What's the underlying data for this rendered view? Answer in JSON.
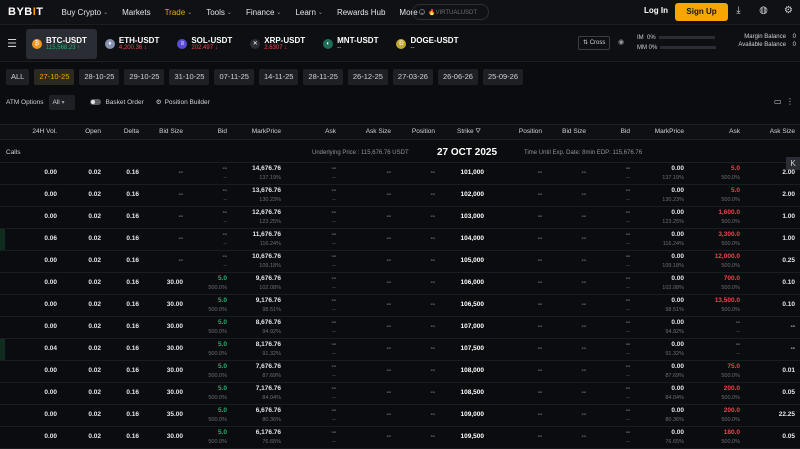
{
  "nav": {
    "logo": "BYB",
    "logo_i": "I",
    "logo_t": "T",
    "items": [
      {
        "label": "Buy Crypto",
        "chev": true
      },
      {
        "label": "Markets",
        "chev": false
      },
      {
        "label": "Trade",
        "chev": true,
        "active": true
      },
      {
        "label": "Tools",
        "chev": true
      },
      {
        "label": "Finance",
        "chev": true
      },
      {
        "label": "Learn",
        "chev": true
      },
      {
        "label": "Rewards Hub",
        "chev": false
      },
      {
        "label": "More",
        "chev": true
      }
    ],
    "search_placeholder": "🔥VIRTUALUSDT",
    "login": "Log In",
    "signup": "Sign Up"
  },
  "tickers": [
    {
      "name": "BTC-USDT",
      "price": "115,568.23",
      "dir": "up",
      "coin": "₿",
      "color": "#f7931a",
      "selected": true
    },
    {
      "name": "ETH-USDT",
      "price": "4,200.36",
      "dir": "dn",
      "coin": "♦",
      "color": "#8a92b2"
    },
    {
      "name": "SOL-USDT",
      "price": "202.497",
      "dir": "dn",
      "coin": "≡",
      "color": "#5a4bd6"
    },
    {
      "name": "XRP-USDT",
      "price": "2.6307",
      "dir": "dn",
      "coin": "✕",
      "color": "#2a2d33"
    },
    {
      "name": "MNT-USDT",
      "price": "--",
      "dir": "",
      "coin": "◐",
      "color": "#1e6e57"
    },
    {
      "name": "DOGE-USDT",
      "price": "--",
      "dir": "",
      "coin": "Ð",
      "color": "#c2a633"
    }
  ],
  "account": {
    "cross": "Cross",
    "im_label": "IM",
    "im_value": "0%",
    "mm_label": "MM",
    "mm_value": "0%",
    "margin_balance_label": "Margin Balance",
    "margin_balance": "0",
    "available_balance_label": "Available Balance",
    "available_balance": "0"
  },
  "dates": {
    "all": "ALL",
    "list": [
      "27-10-25",
      "28-10-25",
      "29-10-25",
      "31-10-25",
      "07-11-25",
      "14-11-25",
      "28-11-25",
      "26-12-25",
      "27-03-26",
      "26-06-26",
      "25-09-26"
    ],
    "selected_index": 0
  },
  "options_bar": {
    "atm_label": "ATM Options",
    "atm_value": "All",
    "basket": "Basket Order",
    "builder": "Position Builder"
  },
  "headers": {
    "left": [
      "24H Vol.",
      "Open",
      "Delta",
      "Bid Size",
      "Bid",
      "MarkPrice",
      "Ask",
      "Ask Size",
      "Position"
    ],
    "strike": "Strike",
    "right": [
      "Position",
      "Bid Size",
      "Bid",
      "MarkPrice",
      "Ask",
      "Ask Size"
    ]
  },
  "info": {
    "calls": "Calls",
    "underlying": "Underlying Price : 115,676.76 USDT",
    "expiry": "27 OCT 2025",
    "time_until": "Time Until Exp. Date:  8min  EDP: 115,676.76"
  },
  "rows": [
    {
      "vol": "0.00",
      "open": "0.02",
      "delta": "0.16",
      "bsz": "--",
      "bid": "--",
      "mark": "14,676.76",
      "markiv": "137.19%",
      "ask": "--",
      "asz": "--",
      "pos": "--",
      "strike": "101,000",
      "rpos": "--",
      "rbsz": "--",
      "rbid": "--",
      "rmark": "0.00",
      "rmarkiv": "137.19%",
      "rask": "5.0",
      "raskiv": "500.0%",
      "rasz": "2.00",
      "rbid_sub": "--",
      "bid_sub": "--",
      "ask_sub": "--"
    },
    {
      "vol": "0.00",
      "open": "0.02",
      "delta": "0.16",
      "bsz": "--",
      "bid": "--",
      "mark": "13,676.76",
      "markiv": "130.23%",
      "ask": "--",
      "asz": "--",
      "pos": "--",
      "strike": "102,000",
      "rpos": "--",
      "rbsz": "--",
      "rbid": "--",
      "rmark": "0.00",
      "rmarkiv": "130.23%",
      "rask": "5.0",
      "raskiv": "500.0%",
      "rasz": "2.00",
      "rbid_sub": "--",
      "bid_sub": "--",
      "ask_sub": "--"
    },
    {
      "vol": "0.00",
      "open": "0.02",
      "delta": "0.16",
      "bsz": "--",
      "bid": "--",
      "mark": "12,676.76",
      "markiv": "123.25%",
      "ask": "--",
      "asz": "--",
      "pos": "--",
      "strike": "103,000",
      "rpos": "--",
      "rbsz": "--",
      "rbid": "--",
      "rmark": "0.00",
      "rmarkiv": "123.25%",
      "rask": "1,600.0",
      "raskiv": "500.0%",
      "rasz": "1.00",
      "rbid_sub": "--",
      "bid_sub": "--",
      "ask_sub": "--"
    },
    {
      "vol": "0.06",
      "open": "0.02",
      "delta": "0.16",
      "bsz": "--",
      "bid": "--",
      "mark": "11,676.76",
      "markiv": "116.24%",
      "ask": "--",
      "asz": "--",
      "pos": "--",
      "strike": "104,000",
      "rpos": "--",
      "rbsz": "--",
      "rbid": "--",
      "rmark": "0.00",
      "rmarkiv": "116.24%",
      "rask": "3,300.0",
      "raskiv": "500.0%",
      "rasz": "1.00",
      "rbid_sub": "--",
      "bid_sub": "--",
      "ask_sub": "--",
      "gbar": true
    },
    {
      "vol": "0.00",
      "open": "0.02",
      "delta": "0.16",
      "bsz": "--",
      "bid": "--",
      "mark": "10,676.76",
      "markiv": "109.18%",
      "ask": "--",
      "asz": "--",
      "pos": "--",
      "strike": "105,000",
      "rpos": "--",
      "rbsz": "--",
      "rbid": "--",
      "rmark": "0.00",
      "rmarkiv": "109.18%",
      "rask": "12,000.0",
      "raskiv": "500.0%",
      "rasz": "0.25",
      "rbid_sub": "--",
      "bid_sub": "--",
      "ask_sub": "--"
    },
    {
      "vol": "0.00",
      "open": "0.02",
      "delta": "0.16",
      "bsz": "30.00",
      "bid": "5.0",
      "mark": "9,676.76",
      "markiv": "102.08%",
      "ask": "--",
      "asz": "--",
      "pos": "--",
      "strike": "106,000",
      "rpos": "--",
      "rbsz": "--",
      "rbid": "--",
      "rmark": "0.00",
      "rmarkiv": "102.08%",
      "rask": "700.0",
      "raskiv": "500.0%",
      "rasz": "0.10",
      "rbid_sub": "--",
      "bid_sub": "500.0%",
      "ask_sub": "--"
    },
    {
      "vol": "0.00",
      "open": "0.02",
      "delta": "0.16",
      "bsz": "30.00",
      "bid": "5.0",
      "mark": "9,176.76",
      "markiv": "98.51%",
      "ask": "--",
      "asz": "--",
      "pos": "--",
      "strike": "106,500",
      "rpos": "--",
      "rbsz": "--",
      "rbid": "--",
      "rmark": "0.00",
      "rmarkiv": "98.51%",
      "rask": "13,500.0",
      "raskiv": "500.0%",
      "rasz": "0.10",
      "rbid_sub": "--",
      "bid_sub": "500.0%",
      "ask_sub": "--"
    },
    {
      "vol": "0.00",
      "open": "0.02",
      "delta": "0.16",
      "bsz": "30.00",
      "bid": "5.0",
      "mark": "8,676.76",
      "markiv": "94.92%",
      "ask": "--",
      "asz": "--",
      "pos": "--",
      "strike": "107,000",
      "rpos": "--",
      "rbsz": "--",
      "rbid": "--",
      "rmark": "0.00",
      "rmarkiv": "94.92%",
      "rask": "--",
      "raskiv": "--",
      "rasz": "--",
      "rbid_sub": "--",
      "bid_sub": "500.0%",
      "ask_sub": "--"
    },
    {
      "vol": "0.04",
      "open": "0.02",
      "delta": "0.16",
      "bsz": "30.00",
      "bid": "5.0",
      "mark": "8,176.76",
      "markiv": "91.32%",
      "ask": "--",
      "asz": "--",
      "pos": "--",
      "strike": "107,500",
      "rpos": "--",
      "rbsz": "--",
      "rbid": "--",
      "rmark": "0.00",
      "rmarkiv": "91.32%",
      "rask": "--",
      "raskiv": "--",
      "rasz": "--",
      "rbid_sub": "--",
      "bid_sub": "500.0%",
      "ask_sub": "--",
      "gbar": true
    },
    {
      "vol": "0.00",
      "open": "0.02",
      "delta": "0.16",
      "bsz": "30.00",
      "bid": "5.0",
      "mark": "7,676.76",
      "markiv": "87.69%",
      "ask": "--",
      "asz": "--",
      "pos": "--",
      "strike": "108,000",
      "rpos": "--",
      "rbsz": "--",
      "rbid": "--",
      "rmark": "0.00",
      "rmarkiv": "87.69%",
      "rask": "75.0",
      "raskiv": "500.0%",
      "rasz": "0.01",
      "rbid_sub": "--",
      "bid_sub": "500.0%",
      "ask_sub": "--"
    },
    {
      "vol": "0.00",
      "open": "0.02",
      "delta": "0.16",
      "bsz": "30.00",
      "bid": "5.0",
      "mark": "7,176.76",
      "markiv": "84.04%",
      "ask": "--",
      "asz": "--",
      "pos": "--",
      "strike": "108,500",
      "rpos": "--",
      "rbsz": "--",
      "rbid": "--",
      "rmark": "0.00",
      "rmarkiv": "84.04%",
      "rask": "200.0",
      "raskiv": "500.0%",
      "rasz": "0.05",
      "rbid_sub": "--",
      "bid_sub": "500.0%",
      "ask_sub": "--"
    },
    {
      "vol": "0.00",
      "open": "0.02",
      "delta": "0.16",
      "bsz": "35.00",
      "bid": "5.0",
      "mark": "6,676.76",
      "markiv": "80.36%",
      "ask": "--",
      "asz": "--",
      "pos": "--",
      "strike": "109,000",
      "rpos": "--",
      "rbsz": "--",
      "rbid": "--",
      "rmark": "0.00",
      "rmarkiv": "80.36%",
      "rask": "200.0",
      "raskiv": "500.0%",
      "rasz": "22.25",
      "rbid_sub": "--",
      "bid_sub": "500.0%",
      "ask_sub": "--"
    },
    {
      "vol": "0.00",
      "open": "0.02",
      "delta": "0.16",
      "bsz": "30.00",
      "bid": "5.0",
      "mark": "6,176.76",
      "markiv": "76.65%",
      "ask": "--",
      "asz": "--",
      "pos": "--",
      "strike": "109,500",
      "rpos": "--",
      "rbsz": "--",
      "rbid": "--",
      "rmark": "0.00",
      "rmarkiv": "76.65%",
      "rask": "180.0",
      "raskiv": "500.0%",
      "rasz": "0.05",
      "rbid_sub": "--",
      "bid_sub": "500.0%",
      "ask_sub": "--"
    }
  ],
  "colors": {
    "accent": "#f7a600",
    "up": "#20b26c",
    "down": "#ef454a",
    "bg": "#0b0c0f"
  }
}
